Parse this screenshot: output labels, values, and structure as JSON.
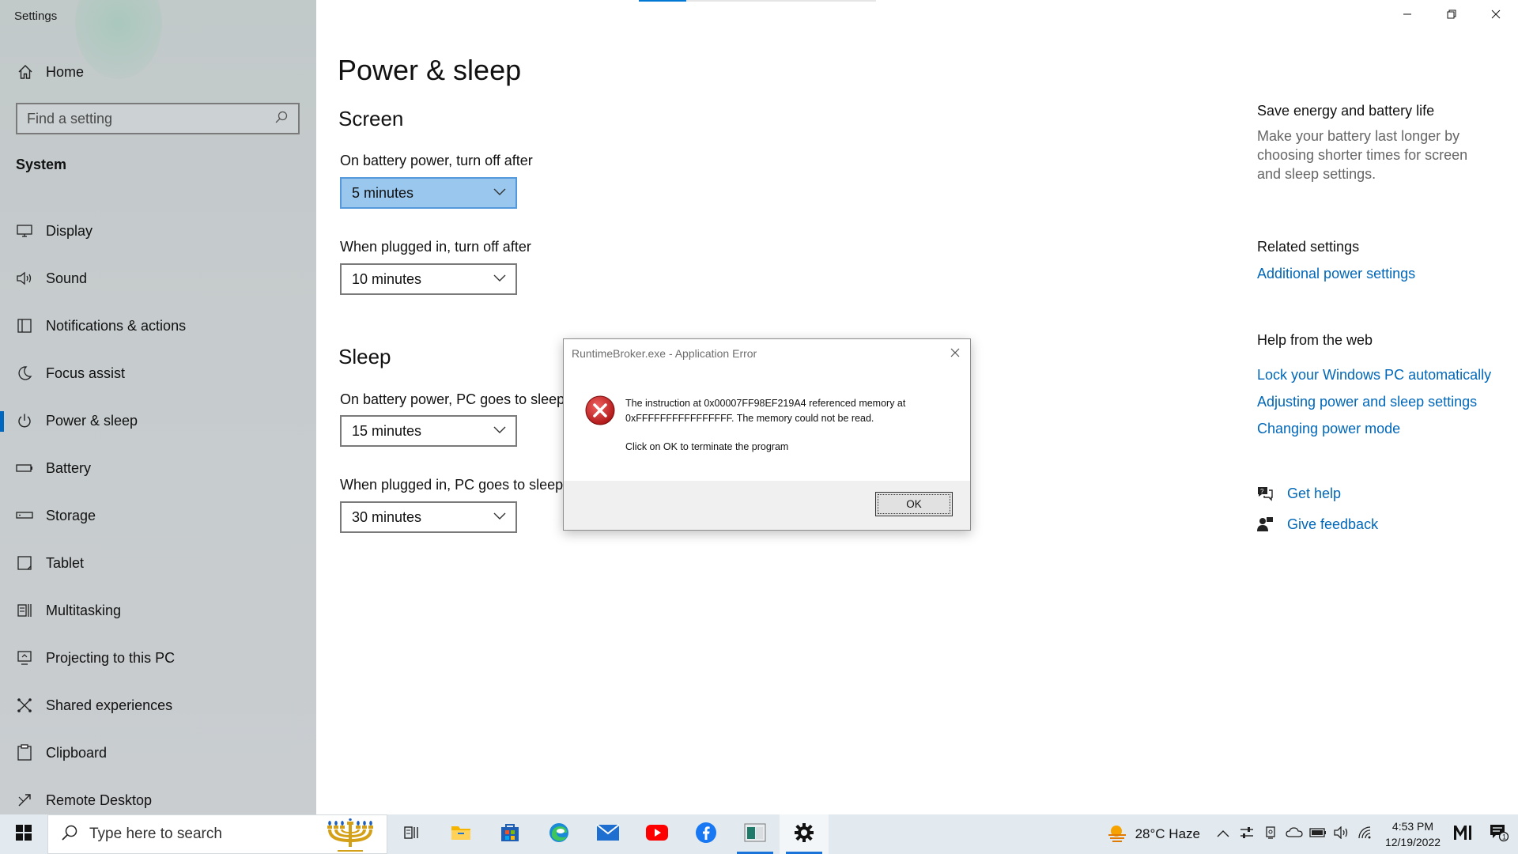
{
  "window": {
    "app_title": "Settings",
    "page_title": "Power & sleep"
  },
  "sidebar": {
    "home_label": "Home",
    "search_placeholder": "Find a setting",
    "section_label": "System",
    "items": [
      {
        "label": "Display",
        "icon": "monitor-icon"
      },
      {
        "label": "Sound",
        "icon": "speaker-icon"
      },
      {
        "label": "Notifications & actions",
        "icon": "notification-icon"
      },
      {
        "label": "Focus assist",
        "icon": "moon-icon"
      },
      {
        "label": "Power & sleep",
        "icon": "power-icon",
        "active": true
      },
      {
        "label": "Battery",
        "icon": "battery-icon"
      },
      {
        "label": "Storage",
        "icon": "storage-icon"
      },
      {
        "label": "Tablet",
        "icon": "tablet-icon"
      },
      {
        "label": "Multitasking",
        "icon": "multitasking-icon"
      },
      {
        "label": "Projecting to this PC",
        "icon": "projecting-icon"
      },
      {
        "label": "Shared experiences",
        "icon": "shared-icon"
      },
      {
        "label": "Clipboard",
        "icon": "clipboard-icon"
      },
      {
        "label": "Remote Desktop",
        "icon": "remote-desktop-icon"
      }
    ]
  },
  "screen": {
    "heading": "Screen",
    "battery_label": "On battery power, turn off after",
    "battery_value": "5 minutes",
    "plugged_label": "When plugged in, turn off after",
    "plugged_value": "10 minutes"
  },
  "sleep": {
    "heading": "Sleep",
    "battery_label": "On battery power, PC goes to sleep after",
    "battery_value": "15 minutes",
    "plugged_label": "When plugged in, PC goes to sleep after",
    "plugged_value": "30 minutes"
  },
  "right_panel": {
    "save_heading": "Save energy and battery life",
    "save_text": "Make your battery last longer by choosing shorter times for screen and sleep settings.",
    "related_heading": "Related settings",
    "related_link": "Additional power settings",
    "web_heading": "Help from the web",
    "web_links": [
      "Lock your Windows PC automatically",
      "Adjusting power and sleep settings",
      "Changing power mode"
    ],
    "get_help": "Get help",
    "give_feedback": "Give feedback"
  },
  "dialog": {
    "title": "RuntimeBroker.exe - Application Error",
    "message": "The instruction at 0x00007FF98EF219A4 referenced memory at 0xFFFFFFFFFFFFFFFF. The memory could not be read.",
    "message2": "Click on OK to terminate the program",
    "ok_label": "OK"
  },
  "taskbar": {
    "search_placeholder": "Type here to search",
    "weather": "28°C  Haze",
    "time": "4:53 PM",
    "date": "12/19/2022",
    "notification_count": "1"
  },
  "colors": {
    "accent": "#0067c0",
    "link": "#0067b8",
    "focused_combo": "#99c7ee",
    "error_red": "#d32f2f"
  }
}
